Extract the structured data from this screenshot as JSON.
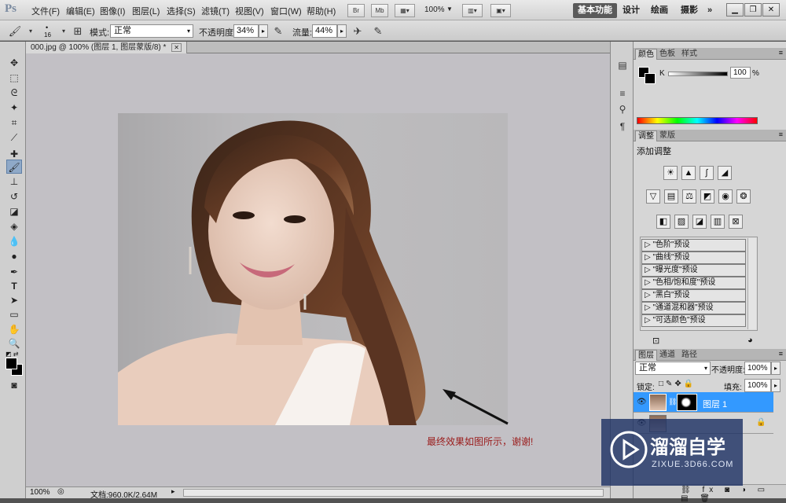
{
  "app": {
    "logo": "Ps"
  },
  "menu": [
    "文件(F)",
    "编辑(E)",
    "图像(I)",
    "图层(L)",
    "选择(S)",
    "滤镜(T)",
    "视图(V)",
    "窗口(W)",
    "帮助(H)"
  ],
  "menubar_extra": {
    "br": "Br",
    "mb": "Mb",
    "zoom": "100%"
  },
  "workspaces": [
    "基本功能",
    "设计",
    "绘画",
    "摄影",
    "»"
  ],
  "options": {
    "brush_size": "16",
    "mode_label": "模式:",
    "mode_value": "正常",
    "opacity_label": "不透明度:",
    "opacity_value": "34%",
    "flow_label": "流量:",
    "flow_value": "44%"
  },
  "document": {
    "tab_title": "000.jpg @ 100% (图层 1, 图层蒙版/8) *",
    "caption": "最终效果如图所示，谢谢!",
    "zoom": "100%",
    "doc_size": "文档:960.0K/2.64M"
  },
  "color_panel": {
    "tabs": [
      "颜色",
      "色板",
      "样式"
    ],
    "channel_label": "K",
    "value": "100",
    "unit": "%"
  },
  "adjust_panel": {
    "tabs": [
      "调整",
      "蒙版"
    ],
    "title": "添加调整",
    "presets": [
      "\"色阶\"预设",
      "\"曲线\"预设",
      "\"曝光度\"预设",
      "\"色相/饱和度\"预设",
      "\"黑白\"预设",
      "\"通道混和器\"预设",
      "\"可选颜色\"预设"
    ]
  },
  "layers_panel": {
    "tabs": [
      "图层",
      "通道",
      "路径"
    ],
    "blend_mode": "正常",
    "opacity_label": "不透明度:",
    "opacity_value": "100%",
    "lock_label": "锁定:",
    "fill_label": "填充:",
    "fill_value": "100%",
    "layer_name": "图层 1"
  },
  "watermark": {
    "brand": "溜溜自学",
    "url": "ZIXUE.3D66.COM"
  },
  "colors": {
    "accent": "#3399ff",
    "caption": "#9a1b1b",
    "watermark_bg": "#1e3264"
  }
}
